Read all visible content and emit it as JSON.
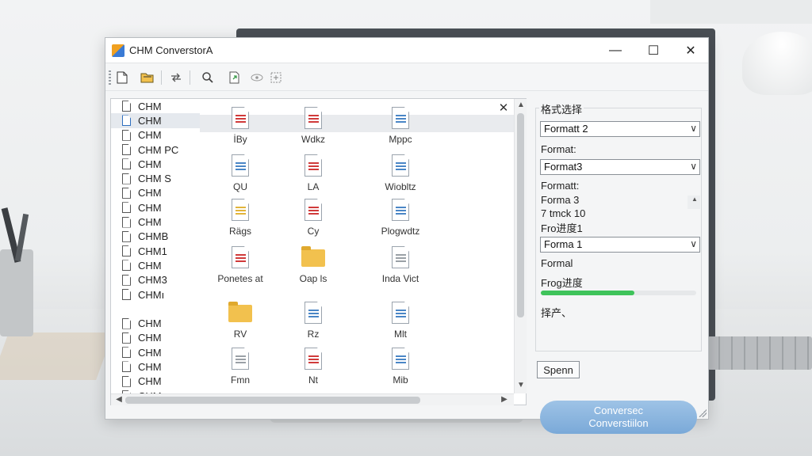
{
  "window": {
    "title": "CHM ConverstorА"
  },
  "window_controls": {
    "minimize": "—",
    "maximize": "☐",
    "close": "✕"
  },
  "toolbar": {
    "icons": [
      "new-file-icon",
      "open-folder-icon",
      "refresh-icon",
      "search-icon",
      "export-icon",
      "view-icon",
      "settings-icon"
    ]
  },
  "file_tree": {
    "items": [
      {
        "label": "CHM",
        "icon": "gray"
      },
      {
        "label": "CHM",
        "icon": "blue",
        "selected": true
      },
      {
        "label": "CHM",
        "icon": "gray"
      },
      {
        "label": "CHM PC",
        "icon": "blue"
      },
      {
        "label": "CHM",
        "icon": "blue"
      },
      {
        "label": "CHM S",
        "icon": "blue"
      },
      {
        "label": "CHM",
        "icon": "blue"
      },
      {
        "label": "CHM",
        "icon": "blue"
      },
      {
        "label": "CHM",
        "icon": "blue"
      },
      {
        "label": "CHMB",
        "icon": "blue"
      },
      {
        "label": "CHM1",
        "icon": "blue"
      },
      {
        "label": "CHM",
        "icon": "blue"
      },
      {
        "label": "CHM3",
        "icon": "blue"
      },
      {
        "label": "CHMı",
        "icon": "blue"
      },
      {
        "label": "",
        "icon": ""
      },
      {
        "label": "CHM",
        "icon": "blue"
      },
      {
        "label": "CHM",
        "icon": "blue"
      },
      {
        "label": "CHM",
        "icon": "blue"
      },
      {
        "label": "CHM",
        "icon": "blue"
      },
      {
        "label": "CHM",
        "icon": "blue"
      },
      {
        "label": "CHM",
        "icon": "blue"
      }
    ]
  },
  "file_grid": {
    "close_label": "✕",
    "tiles": [
      {
        "label": "İВу",
        "kind": "red"
      },
      {
        "label": "Wdkz",
        "kind": "red"
      },
      {
        "label": "Mppc",
        "kind": "blue"
      },
      {
        "label": "QU",
        "kind": "blue"
      },
      {
        "label": "LA",
        "kind": "red"
      },
      {
        "label": "Wiobltz",
        "kind": "blue"
      },
      {
        "label": "Rägs",
        "kind": "yellow"
      },
      {
        "label": "Сy",
        "kind": "red"
      },
      {
        "label": "Plogwdtz",
        "kind": "blue"
      },
      {
        "label": "Ponetes at",
        "kind": "red"
      },
      {
        "label": "Oap ls",
        "kind": "folder"
      },
      {
        "label": "Inda Vict",
        "kind": "gray"
      },
      {
        "label": "RV",
        "kind": "folder"
      },
      {
        "label": "Rz",
        "kind": "blue"
      },
      {
        "label": "Mlt",
        "kind": "blue"
      },
      {
        "label": "Fmn",
        "kind": "gray"
      },
      {
        "label": "Nt",
        "kind": "red"
      },
      {
        "label": "Mib",
        "kind": "blue"
      }
    ]
  },
  "format_panel": {
    "group_title": "格式选择",
    "combo1_value": "Formatt 2",
    "label1": "Format:",
    "combo2_value": "Format3",
    "label2": "Formatt:",
    "list_items": [
      "Forma 3",
      "7 tmck 10",
      "Fro进度1"
    ],
    "combo3_value": "Forma 1",
    "label3": "Formal",
    "progress_label": "Frog进度",
    "progress_value": 0.6,
    "status_text": "择产、"
  },
  "actions": {
    "small_button": "Spenn",
    "convert_line1": "Conversec",
    "convert_line2": "Converstiilon"
  },
  "colors": {
    "accent": "#7aa9d8",
    "progress": "#3fc35b"
  }
}
